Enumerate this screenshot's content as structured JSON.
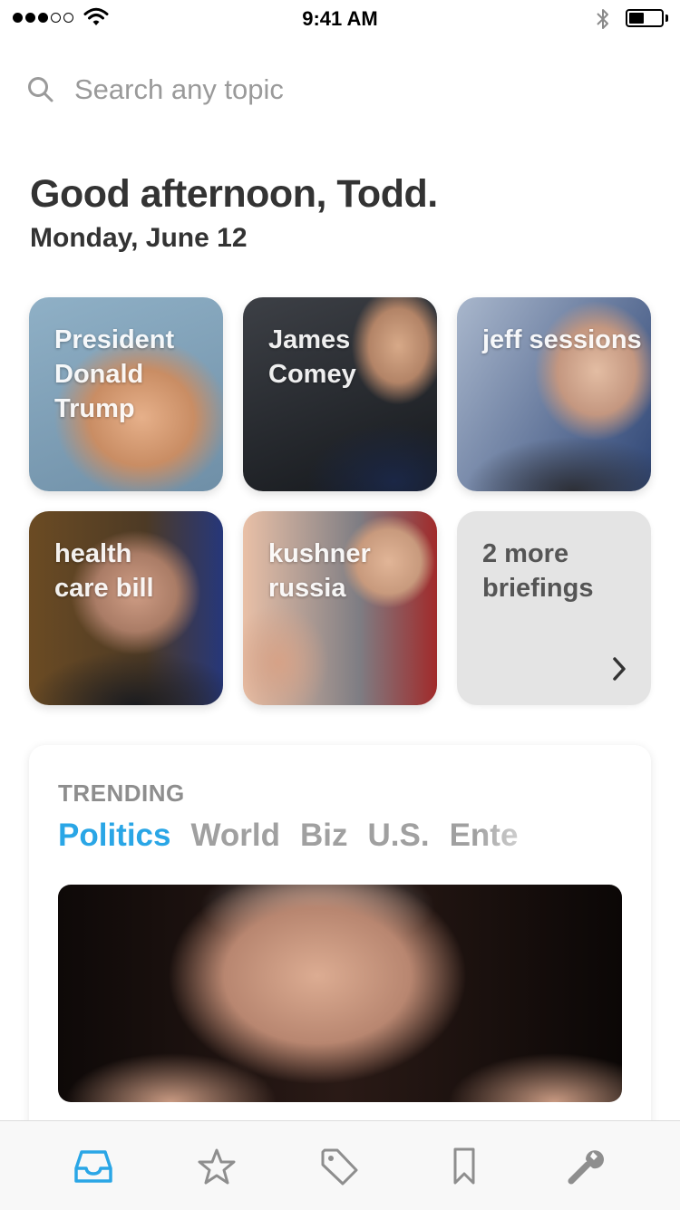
{
  "status_bar": {
    "time": "9:41 AM",
    "signal_bars_filled": 3,
    "signal_bars_total": 5,
    "icons": [
      "wifi-icon",
      "bluetooth-icon",
      "battery-icon"
    ]
  },
  "search": {
    "placeholder": "Search any topic",
    "icon": "search-icon"
  },
  "greeting": {
    "title": "Good afternoon, Todd.",
    "date": "Monday, June 12"
  },
  "briefings": [
    {
      "label": "President Donald Trump"
    },
    {
      "label": "James Comey"
    },
    {
      "label": "jeff sessions"
    },
    {
      "label": "health care bill"
    },
    {
      "label": "kushner russia"
    },
    {
      "label": "2 more briefings",
      "icon": "chevron-right-icon"
    }
  ],
  "trending": {
    "heading": "TRENDING",
    "tabs": [
      "Politics",
      "World",
      "Biz",
      "U.S.",
      "Ente"
    ],
    "active_tab": "Politics"
  },
  "tab_bar": {
    "items": [
      "inbox-icon",
      "star-icon",
      "tag-icon",
      "bookmark-icon",
      "wrench-icon"
    ],
    "active_color": "#2aa6e6",
    "inactive_color": "#8e8e8e"
  },
  "colors": {
    "accent": "#2aa6e6",
    "text": "#333333",
    "muted": "#9a9a9a"
  }
}
